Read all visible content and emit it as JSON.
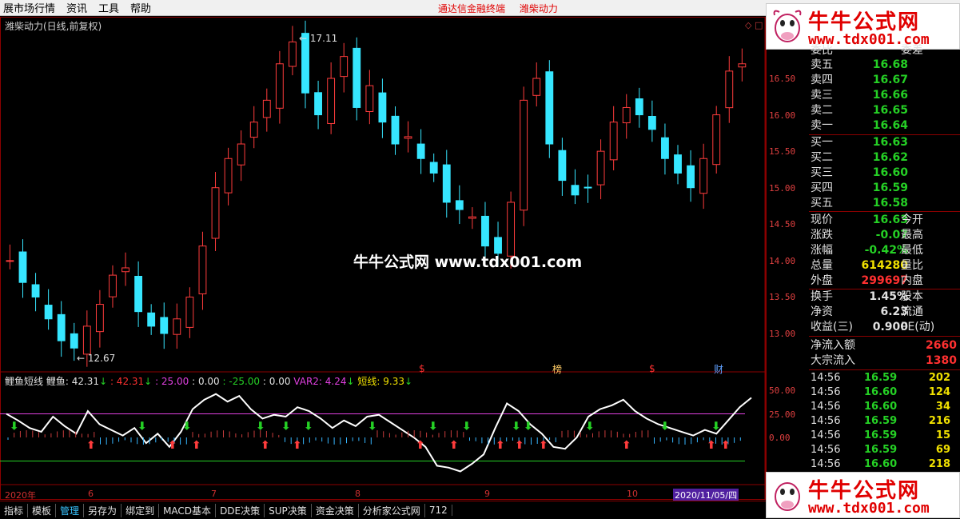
{
  "menu": {
    "items": [
      "展市场行情",
      "资讯",
      "工具",
      "帮助"
    ],
    "center": [
      "通达信金融终端",
      "潍柴动力"
    ]
  },
  "main_chart": {
    "title": "潍柴动力(日线,前复权)",
    "high_label": "17.11",
    "low_label": "12.67",
    "y_ticks": [
      "16.50",
      "16.00",
      "15.50",
      "15.00",
      "14.50",
      "14.00",
      "13.50",
      "13.00"
    ],
    "markers": [
      "$",
      "榜",
      "$",
      "财"
    ]
  },
  "watermark": "牛牛公式网 www.tdx001.com",
  "indicator": {
    "name": "鲤鱼短线",
    "carp_label": "鲤鱼: 42.31",
    "v2": ": 42.31",
    "v3": ": 25.00",
    "v4": ": 0.00",
    "v5": ": -25.00",
    "v6": ": 0.00",
    "var2": "VAR2: 4.24",
    "short": "短线: 9.33",
    "y_ticks": [
      "50.00",
      "25.00",
      "0.00"
    ]
  },
  "date_axis": {
    "labels": [
      "2020年",
      "6",
      "7",
      "8",
      "9",
      "10"
    ],
    "current": "2020/11/05/四"
  },
  "tabs": [
    "指标",
    "模板",
    "管理",
    "另存为",
    "绑定到",
    "MACD基本",
    "DDE决策",
    "SUP决策",
    "资金决策",
    "分析家公式网",
    "712"
  ],
  "quote": {
    "top_cut": {
      "label": "委比",
      "label2": "委差"
    },
    "sell": [
      {
        "label": "卖五",
        "price": "16.68"
      },
      {
        "label": "卖四",
        "price": "16.67"
      },
      {
        "label": "卖三",
        "price": "16.66"
      },
      {
        "label": "卖二",
        "price": "16.65"
      },
      {
        "label": "卖一",
        "price": "16.64"
      }
    ],
    "buy": [
      {
        "label": "买一",
        "price": "16.63"
      },
      {
        "label": "买二",
        "price": "16.62"
      },
      {
        "label": "买三",
        "price": "16.60"
      },
      {
        "label": "买四",
        "price": "16.59"
      },
      {
        "label": "买五",
        "price": "16.58"
      }
    ],
    "stats": [
      {
        "label": "现价",
        "value": "16.63",
        "label2": "今开",
        "color": "#25d025"
      },
      {
        "label": "涨跌",
        "value": "-0.07",
        "label2": "最高",
        "color": "#25d025"
      },
      {
        "label": "涨幅",
        "value": "-0.42%",
        "label2": "最低",
        "color": "#25d025"
      },
      {
        "label": "总量",
        "value": "614280",
        "label2": "量比",
        "color": "#f0e000"
      },
      {
        "label": "外盘",
        "value": "299697",
        "label2": "内盘",
        "color": "#ff3030"
      }
    ],
    "stats2": [
      {
        "label": "换手",
        "value": "1.45%",
        "label2": "股本",
        "color": "#e0e0e0"
      },
      {
        "label": "净资",
        "value": "6.23",
        "label2": "流通",
        "color": "#e0e0e0"
      },
      {
        "label": "收益(三)",
        "value": "0.900",
        "label2": "PE(动)",
        "color": "#e0e0e0"
      }
    ],
    "flows": [
      {
        "label": "净流入额",
        "value": "2660"
      },
      {
        "label": "大宗流入",
        "value": "1380"
      }
    ],
    "ticks": [
      {
        "time": "14:56",
        "price": "16.59",
        "vol": "202"
      },
      {
        "time": "14:56",
        "price": "16.60",
        "vol": "124"
      },
      {
        "time": "14:56",
        "price": "16.60",
        "vol": "34"
      },
      {
        "time": "14:56",
        "price": "16.59",
        "vol": "216"
      },
      {
        "time": "14:56",
        "price": "16.59",
        "vol": "15"
      },
      {
        "time": "14:56",
        "price": "16.59",
        "vol": "69"
      },
      {
        "time": "14:56",
        "price": "16.60",
        "vol": "218"
      }
    ]
  },
  "logo": {
    "title": "牛牛公式网",
    "url": "www.tdx001.com"
  }
}
